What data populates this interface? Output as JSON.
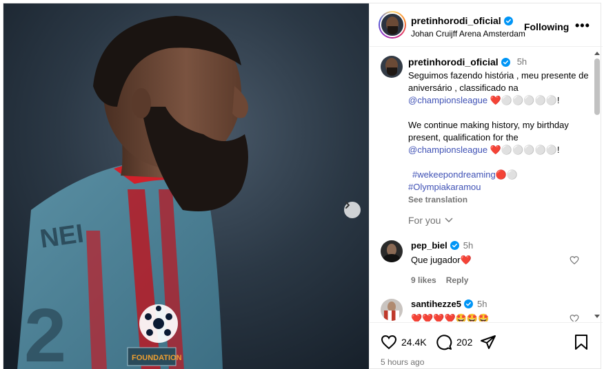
{
  "post": {
    "username": "pretinhorodi_oficial",
    "location": "Johan Cruijff Arena Amsterdam",
    "follow_label": "Following",
    "more_label": "•••"
  },
  "caption": {
    "username": "pretinhorodi_oficial",
    "time": "5h",
    "line1": "Seguimos fazendo história , meu presente de aniversário , classificado na",
    "mention1": "@championsleague",
    "after1": "❤️⚪⚪⚪⚪⚪!",
    "line2": "We continue making history, my birthday present, qualification for the",
    "mention2": "@championsleague",
    "after2": "❤️⚪⚪⚪⚪⚪!",
    "hashtag1": "#wekeepondreaming",
    "hashtag1_after": "🔴⚪",
    "hashtag2": "#Olympiakaramou",
    "see_translation": "See translation"
  },
  "for_you_label": "For you",
  "comments": [
    {
      "username": "pep_biel",
      "time": "5h",
      "text": "Que jugador❤️",
      "likes": "9 likes",
      "reply": "Reply"
    },
    {
      "username": "santihezze5",
      "time": "5h",
      "text": "❤️❤️❤️❤️🤩🤩🤩"
    }
  ],
  "actions": {
    "likes_count": "24.4K",
    "comments_count": "202",
    "time_ago": "5 hours ago"
  },
  "icons": [
    "verified-badge-icon",
    "more-options-icon",
    "chevron-right-icon",
    "chevron-down-icon",
    "heart-icon",
    "comment-icon",
    "share-icon",
    "bookmark-icon"
  ],
  "colors": {
    "verified": "#0095f6",
    "mention": "#3f51b5",
    "muted": "#737373"
  }
}
